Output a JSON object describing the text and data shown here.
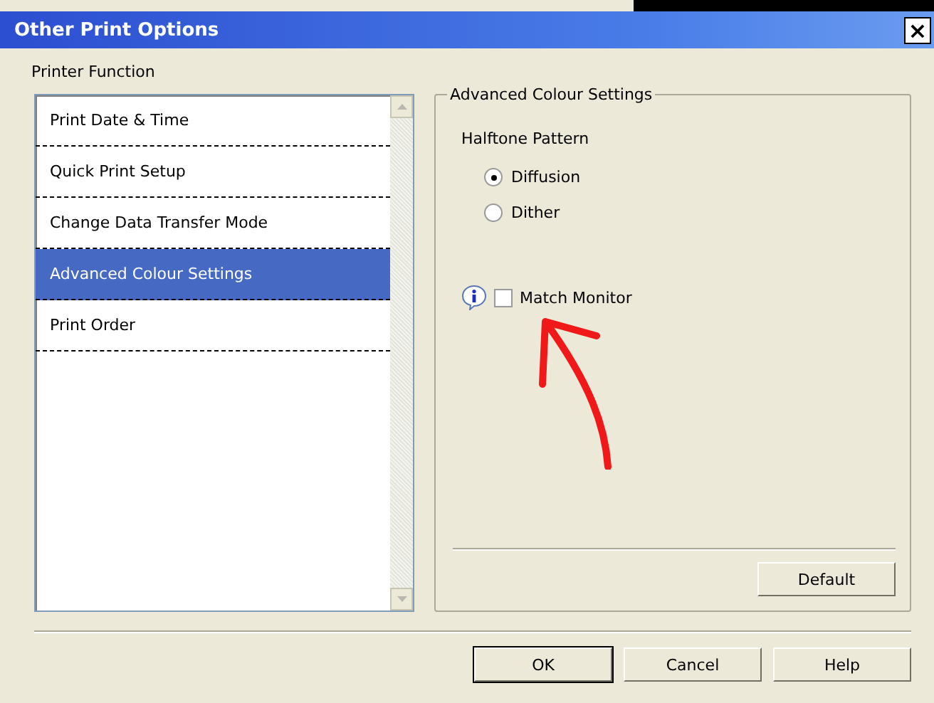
{
  "window": {
    "title": "Other Print Options",
    "close_glyph": "×"
  },
  "printer_function": {
    "label": "Printer Function",
    "items": [
      {
        "label": "Print Date & Time",
        "selected": false
      },
      {
        "label": "Quick Print Setup",
        "selected": false
      },
      {
        "label": "Change Data Transfer Mode",
        "selected": false
      },
      {
        "label": "Advanced Colour Settings",
        "selected": true
      },
      {
        "label": "Print Order",
        "selected": false
      }
    ]
  },
  "group": {
    "title": "Advanced Colour Settings",
    "halftone_label": "Halftone Pattern",
    "options": [
      {
        "label": "Diffusion",
        "selected": true
      },
      {
        "label": "Dither",
        "selected": false
      }
    ],
    "match_monitor": {
      "label": "Match Monitor",
      "checked": false
    },
    "default_button": "Default"
  },
  "buttons": [
    "OK",
    "Cancel",
    "Help"
  ]
}
